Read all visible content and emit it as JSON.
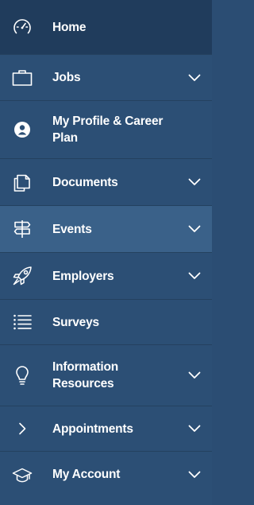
{
  "nav": {
    "items": [
      {
        "label": "Home",
        "icon": "speedometer-icon",
        "expandable": false
      },
      {
        "label": "Jobs",
        "icon": "briefcase-icon",
        "expandable": true
      },
      {
        "label": "My Profile & Career Plan",
        "icon": "profile-icon",
        "expandable": false
      },
      {
        "label": "Documents",
        "icon": "documents-icon",
        "expandable": true
      },
      {
        "label": "Events",
        "icon": "signpost-icon",
        "expandable": true
      },
      {
        "label": "Employers",
        "icon": "rocket-icon",
        "expandable": true
      },
      {
        "label": "Surveys",
        "icon": "list-icon",
        "expandable": false
      },
      {
        "label": "Information Resources",
        "icon": "lightbulb-icon",
        "expandable": true
      },
      {
        "label": "Appointments",
        "icon": "chevron-right-icon",
        "expandable": true
      },
      {
        "label": "My Account",
        "icon": "graduation-cap-icon",
        "expandable": true
      }
    ]
  },
  "colors": {
    "background": "#2c4f75",
    "home_background": "#203c5c",
    "active_background": "#3a6189",
    "text": "#ffffff"
  }
}
